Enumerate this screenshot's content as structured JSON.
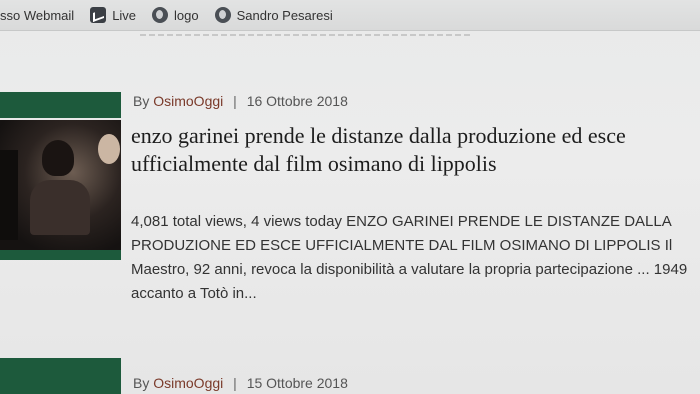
{
  "bookmarks": [
    {
      "label": "sso Webmail",
      "icon": "none"
    },
    {
      "label": "Live",
      "icon": "live-icon"
    },
    {
      "label": "logo",
      "icon": "globe-icon"
    },
    {
      "label": "Sandro Pesaresi",
      "icon": "globe-icon"
    }
  ],
  "article1": {
    "by": "By",
    "author": "OsimoOggi",
    "separator": "|",
    "date": "16 Ottobre 2018",
    "title": "enzo garinei prende le distanze dalla produzione ed esce ufficialmente dal film osimano di lippolis",
    "excerpt": "4,081 total views, 4 views today ENZO GARINEI PRENDE LE DISTANZE DALLA PRODUZIONE ED ESCE UFFICIALMENTE DAL FILM OSIMANO DI LIPPOLIS Il Maestro, 92 anni, revoca la disponibilità a valutare la propria partecipazione ... 1949 accanto a Totò in..."
  },
  "article2": {
    "by": "By",
    "author": "OsimoOggi",
    "separator": "|",
    "date": "15 Ottobre 2018"
  },
  "colors": {
    "thumb_green": "#1d5a3c",
    "author_link": "#7a3a2a"
  }
}
